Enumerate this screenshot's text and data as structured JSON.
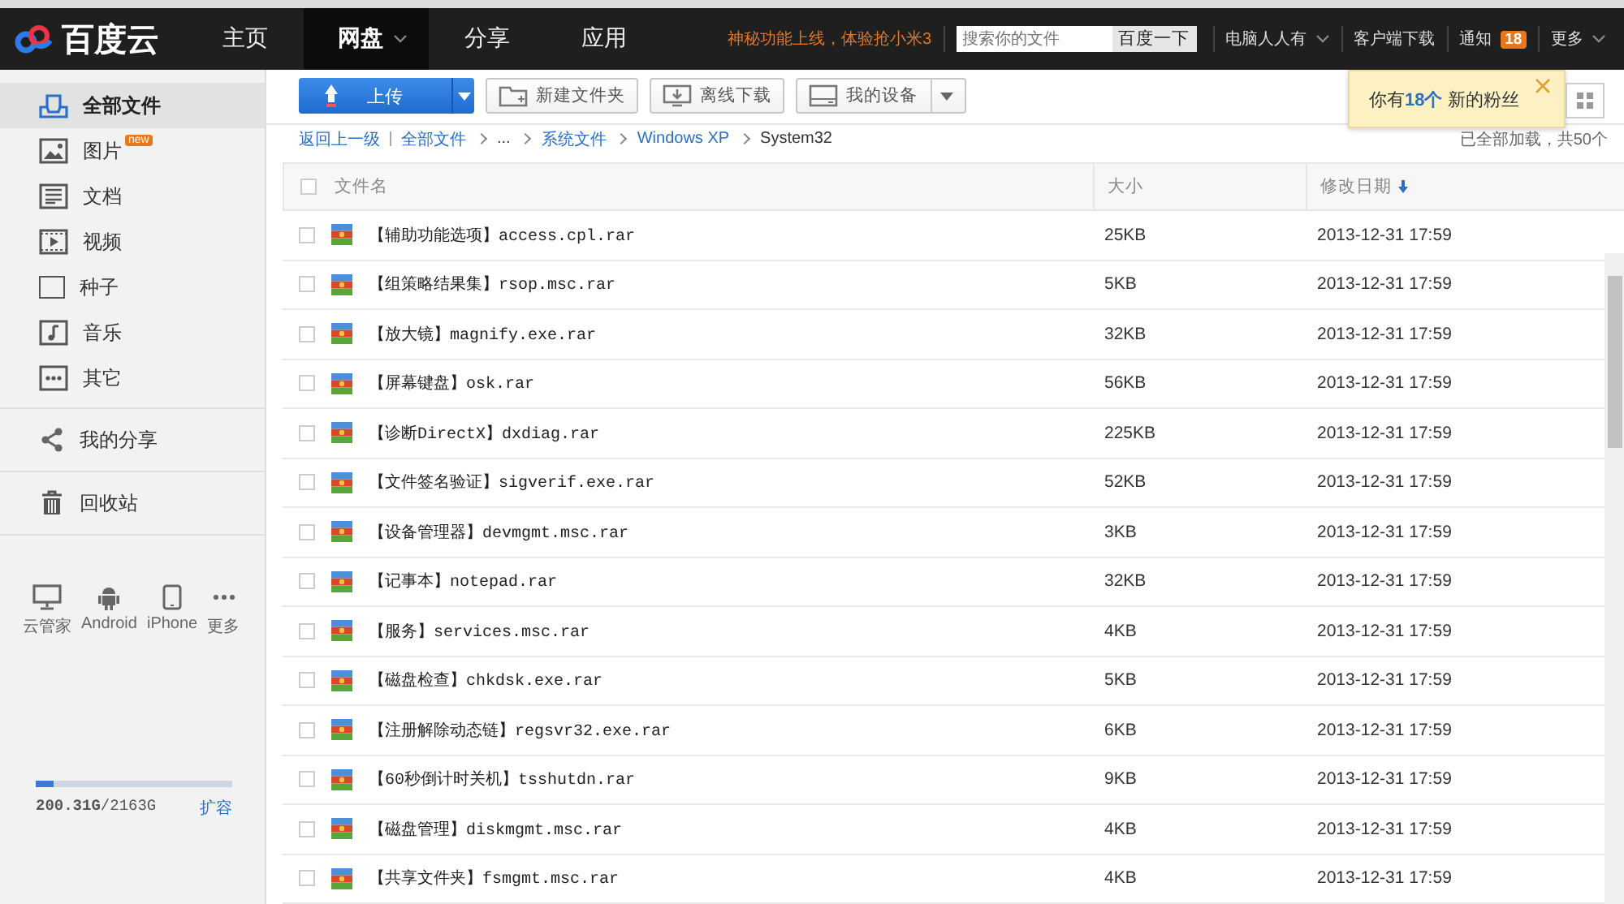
{
  "top_bar": {
    "logo": "百度云",
    "nav": [
      {
        "label": "主页",
        "selected": false,
        "dropdown": false
      },
      {
        "label": "网盘",
        "selected": true,
        "dropdown": true
      },
      {
        "label": "分享",
        "selected": false,
        "dropdown": false
      },
      {
        "label": "应用",
        "selected": false,
        "dropdown": false
      }
    ],
    "promo": "神秘功能上线，体验抢小米3",
    "search": {
      "placeholder": "搜索你的文件",
      "button": "百度一下"
    },
    "user": "电脑人人有",
    "client_download": "客户端下载",
    "notifications": {
      "label": "通知",
      "count": "18"
    },
    "more": "更多"
  },
  "sidebar": {
    "items": [
      {
        "label": "全部文件",
        "selected": true
      },
      {
        "label": "图片",
        "selected": false,
        "badge": "new"
      },
      {
        "label": "文档",
        "selected": false
      },
      {
        "label": "视频",
        "selected": false
      },
      {
        "label": "种子",
        "selected": false
      },
      {
        "label": "音乐",
        "selected": false
      },
      {
        "label": "其它",
        "selected": false
      }
    ],
    "extra_items": [
      {
        "label": "我的分享"
      },
      {
        "label": "回收站"
      }
    ],
    "devices": [
      {
        "label": "云管家"
      },
      {
        "label": "Android"
      },
      {
        "label": "iPhone"
      },
      {
        "label": "更多"
      }
    ],
    "storage": {
      "level": 0.09,
      "used": "200.31G",
      "total": "/2163G",
      "expand": "扩容"
    }
  },
  "toolbar": {
    "upload": "上传",
    "buttons": [
      {
        "label": "新建文件夹",
        "dropdown": false
      },
      {
        "label": "离线下载",
        "dropdown": false
      },
      {
        "label": "我的设备",
        "dropdown": true
      }
    ]
  },
  "notice": {
    "parts": [
      "你有",
      "18个",
      "新的粉丝"
    ]
  },
  "breadcrumb": {
    "back": "返回上一级",
    "path": [
      {
        "label": "全部文件",
        "link": true
      },
      {
        "label": "...",
        "link": false
      },
      {
        "label": "系统文件",
        "link": true
      },
      {
        "label": "Windows XP",
        "link": true
      },
      {
        "label": "System32",
        "link": false
      }
    ],
    "status": "已全部加载，共50个"
  },
  "table": {
    "select_all": {
      "checked": false
    },
    "columns": [
      {
        "label": "文件名",
        "sorted": false
      },
      {
        "label": "大小",
        "sorted": false
      },
      {
        "label": "修改日期",
        "sorted": true
      }
    ],
    "rows": [
      {
        "name": "【辅助功能选项】access.cpl.rar",
        "size": "25KB",
        "date": "2013-12-31 17:59",
        "checked": false
      },
      {
        "name": "【组策略结果集】rsop.msc.rar",
        "size": "5KB",
        "date": "2013-12-31 17:59",
        "checked": false
      },
      {
        "name": "【放大镜】magnify.exe.rar",
        "size": "32KB",
        "date": "2013-12-31 17:59",
        "checked": false
      },
      {
        "name": "【屏幕键盘】osk.rar",
        "size": "56KB",
        "date": "2013-12-31 17:59",
        "checked": false
      },
      {
        "name": "【诊断DirectX】dxdiag.rar",
        "size": "225KB",
        "date": "2013-12-31 17:59",
        "checked": false
      },
      {
        "name": "【文件签名验证】sigverif.exe.rar",
        "size": "52KB",
        "date": "2013-12-31 17:59",
        "checked": false
      },
      {
        "name": "【设备管理器】devmgmt.msc.rar",
        "size": "3KB",
        "date": "2013-12-31 17:59",
        "checked": false
      },
      {
        "name": "【记事本】notepad.rar",
        "size": "32KB",
        "date": "2013-12-31 17:59",
        "checked": false
      },
      {
        "name": "【服务】services.msc.rar",
        "size": "4KB",
        "date": "2013-12-31 17:59",
        "checked": false
      },
      {
        "name": "【磁盘检查】chkdsk.exe.rar",
        "size": "5KB",
        "date": "2013-12-31 17:59",
        "checked": false
      },
      {
        "name": "【注册解除动态链】regsvr32.exe.rar",
        "size": "6KB",
        "date": "2013-12-31 17:59",
        "checked": false
      },
      {
        "name": "【60秒倒计时关机】tsshutdn.rar",
        "size": "9KB",
        "date": "2013-12-31 17:59",
        "checked": false
      },
      {
        "name": "【磁盘管理】diskmgmt.msc.rar",
        "size": "4KB",
        "date": "2013-12-31 17:59",
        "checked": false
      },
      {
        "name": "【共享文件夹】fsmgmt.msc.rar",
        "size": "4KB",
        "date": "2013-12-31 17:59",
        "checked": false
      }
    ]
  }
}
